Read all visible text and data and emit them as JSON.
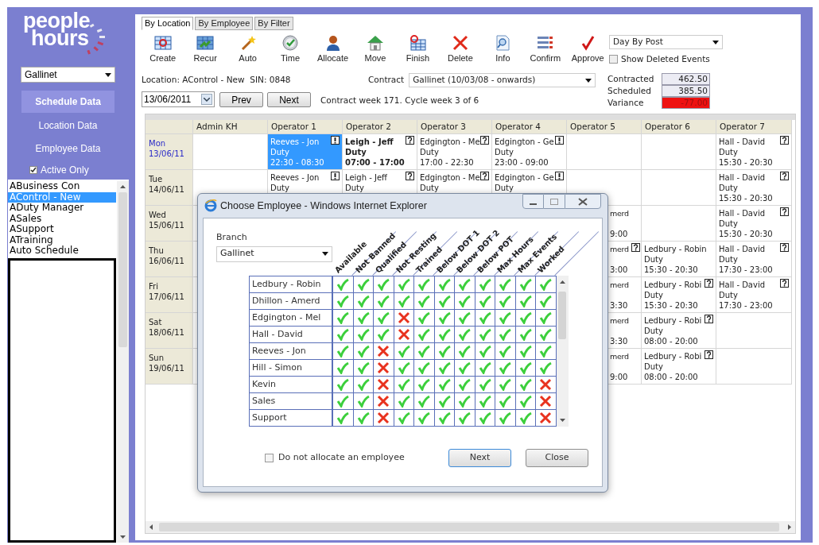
{
  "sidebar": {
    "logo": [
      "people",
      "hours"
    ],
    "branch": "Gallinet",
    "nav": [
      {
        "label": "Schedule Data",
        "selected": true
      },
      {
        "label": "Location Data",
        "selected": false
      },
      {
        "label": "Employee Data",
        "selected": false
      }
    ],
    "active_only": {
      "label": "Active Only",
      "checked": true
    },
    "locations": [
      {
        "label": "ABusiness Con",
        "selected": false
      },
      {
        "label": "AControl - New",
        "selected": true
      },
      {
        "label": "ADuty Manager",
        "selected": false
      },
      {
        "label": "ASales",
        "selected": false
      },
      {
        "label": "ASupport",
        "selected": false
      },
      {
        "label": "ATraining",
        "selected": false
      },
      {
        "label": "Auto Schedule",
        "selected": false
      }
    ]
  },
  "tabs": [
    {
      "label": "By Location",
      "selected": true
    },
    {
      "label": "By Employee",
      "selected": false
    },
    {
      "label": "By Filter",
      "selected": false
    }
  ],
  "toolbar": [
    {
      "kind": "create",
      "label": "Create"
    },
    {
      "kind": "recur",
      "label": "Recur"
    },
    {
      "kind": "auto",
      "label": "Auto"
    },
    {
      "kind": "time",
      "label": "Time"
    },
    {
      "kind": "allocate",
      "label": "Allocate"
    },
    {
      "kind": "move",
      "label": "Move"
    },
    {
      "kind": "finish",
      "label": "Finish"
    },
    {
      "kind": "delete",
      "label": "Delete"
    },
    {
      "kind": "info",
      "label": "Info"
    },
    {
      "kind": "confirm",
      "label": "Confirm"
    },
    {
      "kind": "approve",
      "label": "Approve"
    }
  ],
  "view_select": "Day By Post",
  "show_deleted": {
    "label": "Show Deleted Events",
    "checked": false
  },
  "location_line": "Location: AControl - New  SIN: 0848",
  "contract": {
    "label": "Contract",
    "value": "Gallinet (10/03/08 - onwards)"
  },
  "totals": [
    {
      "label": "Contracted",
      "value": "462.50",
      "negative": false
    },
    {
      "label": "Scheduled",
      "value": "385.50",
      "negative": false
    },
    {
      "label": "Variance",
      "value": "-77.00",
      "negative": true
    }
  ],
  "date": "13/06/2011",
  "prev": "Prev",
  "next": "Next",
  "week_info": "Contract week 171. Cycle week 3 of 6",
  "schedule": {
    "columns": [
      "Admin KH",
      "Operator 1",
      "Operator 2",
      "Operator 3",
      "Operator 4",
      "Operator 5",
      "Operator 6",
      "Operator 7"
    ],
    "rows": [
      {
        "day": "Mon",
        "date": "13/06/11",
        "today": true,
        "cells": [
          null,
          {
            "kind": "shift",
            "name": "Reeves - Jon",
            "type": "Duty",
            "time": "22:30 - 08:30",
            "flag": {
              "kind": "alert"
            },
            "selected": true,
            "bold": false
          },
          {
            "kind": "shift",
            "name": "Leigh - Jeff",
            "type": "Duty",
            "time": "07:00 - 17:00",
            "flag": {
              "kind": "help"
            },
            "selected": false,
            "bold": true
          },
          {
            "kind": "shift",
            "name": "Edgington - Me",
            "type": "Duty",
            "time": "17:00 - 22:30",
            "flag": {
              "kind": "help"
            },
            "selected": false,
            "bold": false
          },
          {
            "kind": "shift",
            "name": "Edgington - Ge",
            "type": "Duty",
            "time": "23:00 - 09:00",
            "flag": {
              "kind": "alert"
            },
            "selected": false,
            "bold": false
          },
          null,
          null,
          {
            "kind": "shift",
            "name": "Hall - David",
            "type": "Duty",
            "time": "15:30 - 20:30",
            "flag": {
              "kind": "help"
            },
            "selected": false,
            "bold": false
          }
        ]
      },
      {
        "day": "Tue",
        "date": "14/06/11",
        "today": false,
        "cells": [
          null,
          {
            "kind": "shift",
            "name": "Reeves - Jon",
            "type": "Duty",
            "flag": {
              "kind": "alert"
            },
            "selected": false,
            "bold": false
          },
          {
            "kind": "shift",
            "name": "Leigh - Jeff",
            "type": "Duty",
            "flag": {
              "kind": "help"
            },
            "selected": false,
            "bold": false
          },
          {
            "kind": "shift",
            "name": "Edgington - Me",
            "type": "Duty",
            "flag": {
              "kind": "help"
            },
            "selected": false,
            "bold": false
          },
          {
            "kind": "shift",
            "name": "Edgington - Ge",
            "type": "Duty",
            "flag": {
              "kind": "alert"
            },
            "selected": false,
            "bold": false
          },
          null,
          null,
          {
            "kind": "shift",
            "name": "Hall - David",
            "type": "Duty",
            "time": "15:30 - 20:30",
            "flag": {
              "kind": "help"
            },
            "selected": false,
            "bold": false
          }
        ]
      },
      {
        "day": "Wed",
        "date": "15/06/11",
        "today": false,
        "cells": [
          null,
          null,
          null,
          null,
          null,
          {
            "kind": "partial",
            "name": "merd",
            "time": "9:00",
            "selected": false,
            "bold": false
          },
          null,
          {
            "kind": "shift",
            "name": "Hall - David",
            "type": "Duty",
            "time": "15:30 - 20:30",
            "flag": {
              "kind": "help"
            },
            "selected": false,
            "bold": false
          }
        ]
      },
      {
        "day": "Thu",
        "date": "16/06/11",
        "today": false,
        "cells": [
          null,
          null,
          null,
          null,
          null,
          {
            "kind": "partial",
            "name": "merd",
            "time": "3:00",
            "flag": {
              "kind": "help"
            },
            "selected": false,
            "bold": false
          },
          {
            "kind": "shift",
            "name": "Ledbury - Robin",
            "type": "Duty",
            "time": "15:30 - 20:30",
            "selected": false,
            "bold": false
          },
          {
            "kind": "shift",
            "name": "Hall - David",
            "type": "Duty",
            "time": "17:30 - 23:00",
            "flag": {
              "kind": "help"
            },
            "selected": false,
            "bold": false
          }
        ]
      },
      {
        "day": "Fri",
        "date": "17/06/11",
        "today": false,
        "cells": [
          null,
          null,
          null,
          null,
          null,
          {
            "kind": "partial",
            "name": "merd",
            "time": "3:30",
            "selected": false,
            "bold": false
          },
          {
            "kind": "shift",
            "name": "Ledbury - Robi",
            "type": "Duty",
            "time": "15:30 - 20:30",
            "flag": {
              "kind": "help"
            },
            "selected": false,
            "bold": false
          },
          {
            "kind": "shift",
            "name": "Hall - David",
            "type": "Duty",
            "time": "17:30 - 23:00",
            "flag": {
              "kind": "help"
            },
            "selected": false,
            "bold": false
          }
        ]
      },
      {
        "day": "Sat",
        "date": "18/06/11",
        "today": false,
        "cells": [
          null,
          null,
          null,
          null,
          null,
          {
            "kind": "partial",
            "name": "merd",
            "time": "3:30",
            "selected": false,
            "bold": false
          },
          {
            "kind": "shift",
            "name": "Ledbury - Robi",
            "type": "Duty",
            "time": "08:00 - 20:00",
            "flag": {
              "kind": "help"
            },
            "selected": false,
            "bold": false
          },
          null
        ]
      },
      {
        "day": "Sun",
        "date": "19/06/11",
        "today": false,
        "cells": [
          null,
          null,
          null,
          null,
          null,
          {
            "kind": "partial",
            "name": "merd",
            "time": "9:00",
            "selected": false,
            "bold": false
          },
          {
            "kind": "shift",
            "name": "Ledbury - Robi",
            "type": "Duty",
            "time": "08:00 - 20:00",
            "flag": {
              "kind": "help"
            },
            "selected": false,
            "bold": false
          },
          null
        ]
      }
    ]
  },
  "dialog": {
    "title": "Choose Employee - Windows Internet Explorer",
    "branch_label": "Branch",
    "branch": "Gallinet",
    "criteria": [
      "Available",
      "Not Banned",
      "Qualified",
      "Not Resting",
      "Trained",
      "Below DOT 1",
      "Below DOT 2",
      "Below POT",
      "Max Hours",
      "Max Events",
      "Worked"
    ],
    "employees": [
      {
        "name": "Ledbury - Robin",
        "checks": [
          true,
          true,
          true,
          true,
          true,
          true,
          true,
          true,
          true,
          true,
          true
        ]
      },
      {
        "name": "Dhillon - Amerd",
        "checks": [
          true,
          true,
          true,
          true,
          true,
          true,
          true,
          true,
          true,
          true,
          true
        ]
      },
      {
        "name": "Edgington - Mel",
        "checks": [
          true,
          true,
          true,
          false,
          true,
          true,
          true,
          true,
          true,
          true,
          true
        ]
      },
      {
        "name": "Hall - David",
        "checks": [
          true,
          true,
          true,
          false,
          true,
          true,
          true,
          true,
          true,
          true,
          true
        ]
      },
      {
        "name": "Reeves - Jon",
        "checks": [
          true,
          true,
          false,
          true,
          true,
          true,
          true,
          true,
          true,
          true,
          true
        ]
      },
      {
        "name": "Hill - Simon",
        "checks": [
          true,
          true,
          false,
          true,
          true,
          true,
          true,
          true,
          true,
          true,
          true
        ]
      },
      {
        "name": "Kevin",
        "checks": [
          true,
          true,
          false,
          true,
          true,
          true,
          true,
          true,
          true,
          true,
          false
        ]
      },
      {
        "name": "Sales",
        "checks": [
          true,
          true,
          false,
          true,
          true,
          true,
          true,
          true,
          true,
          true,
          false
        ]
      },
      {
        "name": "Support",
        "checks": [
          true,
          true,
          false,
          true,
          true,
          true,
          true,
          true,
          true,
          true,
          false
        ]
      }
    ],
    "no_allocate": {
      "label": "Do not allocate an employee",
      "checked": false
    },
    "buttons": [
      "Next",
      "Close"
    ]
  }
}
